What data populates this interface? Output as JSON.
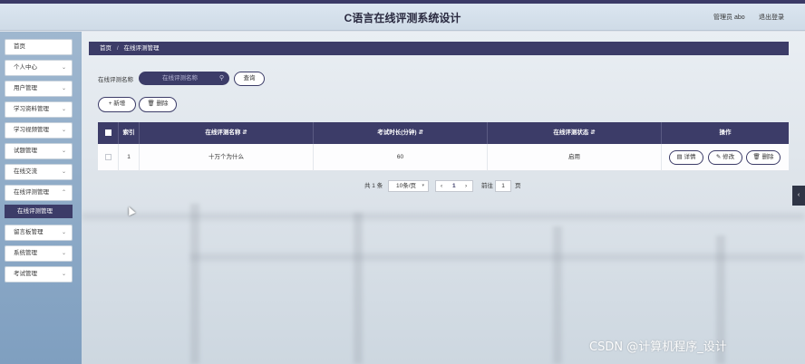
{
  "header": {
    "title": "C语言在线评测系统设计",
    "admin": "管理员 abo",
    "logout": "退出登录"
  },
  "sidebar": {
    "items": [
      {
        "label": "首页",
        "chevron": false
      },
      {
        "label": "个人中心",
        "chevron": true
      },
      {
        "label": "用户管理",
        "chevron": true
      },
      {
        "label": "学习资料管理",
        "chevron": true
      },
      {
        "label": "学习视频管理",
        "chevron": true
      },
      {
        "label": "试题管理",
        "chevron": true
      },
      {
        "label": "在线交流",
        "chevron": true
      },
      {
        "label": "在线评测管理",
        "chevron": true
      }
    ],
    "active_sub": "在线评测管理",
    "items_after": [
      {
        "label": "留言板管理",
        "chevron": true
      },
      {
        "label": "系统管理",
        "chevron": true
      },
      {
        "label": "考试管理",
        "chevron": true
      }
    ]
  },
  "breadcrumb": {
    "home": "首页",
    "separator": "/",
    "current": "在线评测管理"
  },
  "search": {
    "label": "在线评测名称",
    "placeholder": "在线评测名称",
    "query_label": "查询"
  },
  "actions": {
    "add_label": "+ 新增",
    "delete_label": "删除"
  },
  "table": {
    "headers": {
      "index": "索引",
      "name": "在线评测名称",
      "duration": "考试时长(分钟)",
      "status": "在线评测状态",
      "ops": "操作"
    },
    "rows": [
      {
        "index": "1",
        "name": "十万个为什么",
        "duration": "60",
        "status": "启用"
      }
    ],
    "row_ops": {
      "detail": "详情",
      "edit": "修改",
      "delete": "删除"
    }
  },
  "pagination": {
    "total": "共 1 条",
    "page_size": "10条/页",
    "current_page": "1",
    "goto_label": "前往",
    "goto_value": "1",
    "page_unit": "页"
  },
  "watermark": "CSDN @计算机程序_设计",
  "colors": {
    "primary": "#3c3c68",
    "sidebar": "#8fa9c6",
    "header": "#d5e1ec"
  }
}
